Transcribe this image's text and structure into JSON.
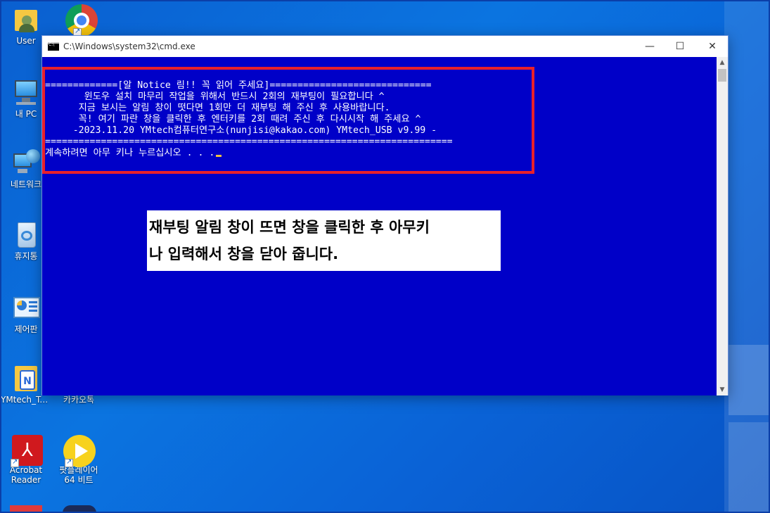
{
  "desktop": {
    "icons": [
      {
        "label": "User",
        "icon": "user-folder-icon"
      },
      {
        "label": "",
        "icon": "chrome-icon"
      },
      {
        "label": "내 PC",
        "icon": "computer-icon"
      },
      {
        "label": "네트워크",
        "icon": "network-icon"
      },
      {
        "label": "휴지통",
        "icon": "recycle-bin-icon"
      },
      {
        "label": "제어판",
        "icon": "control-panel-icon"
      },
      {
        "label": "YMtech_To...",
        "icon": "ymtech-folder-icon"
      },
      {
        "label": "카카오톡",
        "icon": "kakaotalk-icon"
      },
      {
        "label": "Acrobat Reader",
        "icon": "acrobat-icon"
      },
      {
        "label": "팟플레이어 64 비트",
        "icon": "potplayer-icon"
      }
    ],
    "accent": "#0a6ad8"
  },
  "window": {
    "title": "C:\\Windows\\system32\\cmd.exe",
    "minimize": "—",
    "maximize": "☐",
    "close": "✕",
    "console_bg": "#0000c8"
  },
  "console": {
    "lines": [
      "=============[알 Notice 림!! 꼭 읽어 주세요]=============================",
      "       윈도우 설치 마무리 작업을 위해서 반드시 2회의 재부팅이 필요합니다 ^",
      "      지금 보시는 알림 창이 떳다면 1회만 더 재부팅 해 주신 후 사용바랍니다.",
      "      꼭! 여기 파란 창을 클릭한 후 엔터키를 2회 때려 주신 후 다시시작 해 주세요 ^",
      "     -2023.11.20 YMtech컴퓨터연구소(nunjisi@kakao.com) YMtech_USB v9.99 -",
      "=========================================================================",
      "계속하려면 아무 키나 누르십시오 . . ."
    ]
  },
  "annotation": {
    "line1": "재부팅 알림 창이 뜨면 창을 클릭한 후 아무키",
    "line2": "나 입력해서 창을 닫아 줍니다."
  }
}
